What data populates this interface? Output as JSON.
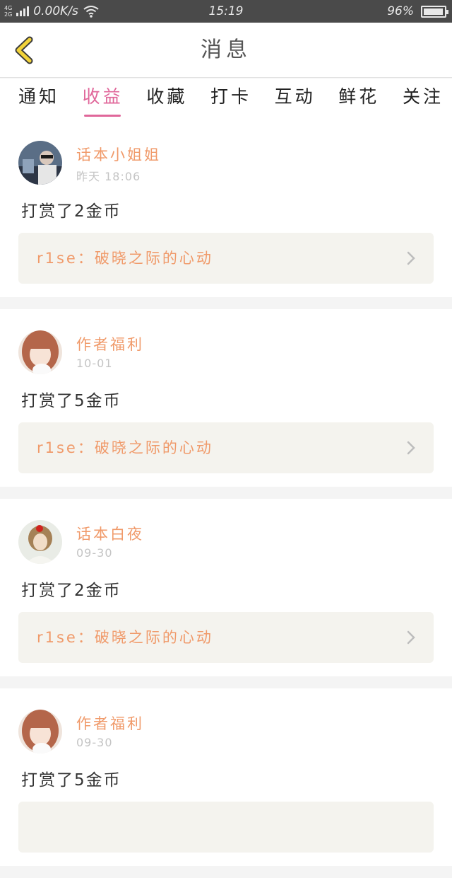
{
  "status_bar": {
    "network_top": "4G",
    "network_bottom": "2G",
    "speed": "0.00K/s",
    "time": "15:19",
    "battery": "96%",
    "battery_level": 0.96
  },
  "header": {
    "title": "消息",
    "back_icon": "chevron-left-icon"
  },
  "tabs": [
    {
      "label": "通知",
      "active": false
    },
    {
      "label": "收益",
      "active": true
    },
    {
      "label": "收藏",
      "active": false
    },
    {
      "label": "打卡",
      "active": false
    },
    {
      "label": "互动",
      "active": false
    },
    {
      "label": "鲜花",
      "active": false
    },
    {
      "label": "关注",
      "active": false
    }
  ],
  "messages": [
    {
      "name": "话本小姐姐",
      "time": "昨天 18:06",
      "action": "打赏了2金币",
      "book": "r1se：破晓之际的心动"
    },
    {
      "name": "作者福利",
      "time": "10-01",
      "action": "打赏了5金币",
      "book": "r1se：破晓之际的心动"
    },
    {
      "name": "话本白夜",
      "time": "09-30",
      "action": "打赏了2金币",
      "book": "r1se：破晓之际的心动"
    },
    {
      "name": "作者福利",
      "time": "09-30",
      "action": "打赏了5金币",
      "book": ""
    }
  ],
  "colors": {
    "accent_pink": "#e0679a",
    "name_orange": "#f09a6a",
    "back_yellow": "#f2d33a"
  }
}
